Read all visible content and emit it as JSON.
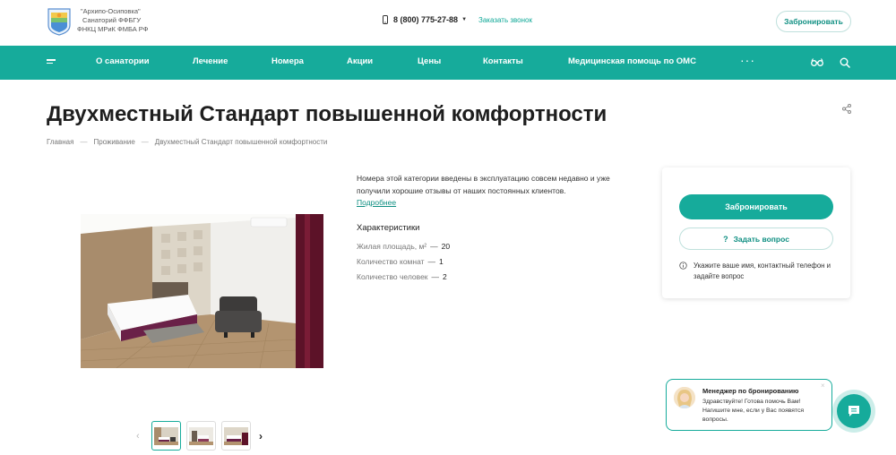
{
  "header": {
    "logo_lines": [
      "\"Архипо-Осиповка\"",
      "Санаторий ФФБГУ",
      "ФНКЦ МРиК ФМБА РФ"
    ],
    "phone": "8 (800) 775-27-88",
    "callback_label": "Заказать звонок",
    "book_label": "Забронировать"
  },
  "nav": {
    "items": [
      "О санатории",
      "Лечение",
      "Номера",
      "Акции",
      "Цены",
      "Контакты",
      "Медицинская помощь по ОМС"
    ],
    "more": "···",
    "icons": [
      "menu-icon",
      "accessibility-glasses-icon",
      "search-icon"
    ],
    "color": "#16ab9b"
  },
  "page": {
    "title": "Двухместный Стандарт повышенной комфортности",
    "breadcrumb": [
      "Главная",
      "Проживание",
      "Двухместный Стандарт повышенной комфортности"
    ]
  },
  "room": {
    "description": "Номера этой категории введены в эксплуатацию совсем недавно и уже получили хорошие отзывы от наших постоянных клиентов.",
    "more_link": "Подробнее",
    "characteristics_title": "Характеристики",
    "characteristics": [
      {
        "label": "Жилая площадь, м²",
        "value": "20"
      },
      {
        "label": "Количество комнат",
        "value": "1"
      },
      {
        "label": "Количество человек",
        "value": "2"
      }
    ]
  },
  "booking_card": {
    "book_label": "Забронировать",
    "ask_label": "Задать вопрос",
    "info_text": "Укажите ваше имя, контактный телефон и задайте вопрос"
  },
  "chat": {
    "manager_title": "Менеджер по бронированию",
    "message": "Здравствуйте! Готова помочь Вам! Нагишите мне, если у Вас появятся вопросы.",
    "close": "×"
  }
}
